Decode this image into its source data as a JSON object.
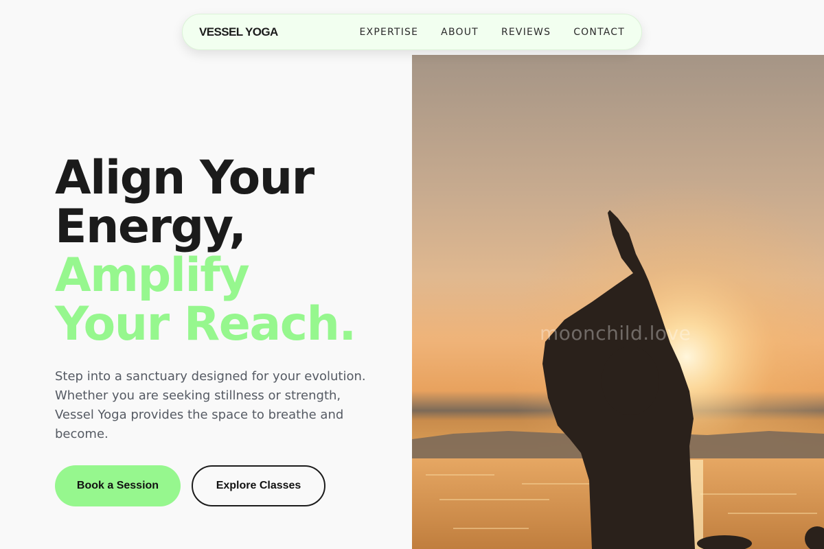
{
  "nav": {
    "brand": "VESSEL YOGA",
    "links": [
      "EXPERTISE",
      "ABOUT",
      "REVIEWS",
      "CONTACT"
    ]
  },
  "hero": {
    "title_lines": [
      "Align Your",
      "Energy,",
      "Amplify",
      "Your Reach."
    ],
    "description": "Step into a sanctuary designed for your evolution. Whether you are seeking stillness or strength, Vessel Yoga provides the space to breathe and become.",
    "primary_button": "Book a Session",
    "secondary_button": "Explore Classes"
  },
  "image": {
    "watermark": "moonchild.love"
  },
  "colors": {
    "accent": "#96f78e",
    "text_dark": "#1b1b1b",
    "text_muted": "#555a63",
    "nav_bg": "#f2fff0",
    "page_bg": "#f9f9f9"
  }
}
